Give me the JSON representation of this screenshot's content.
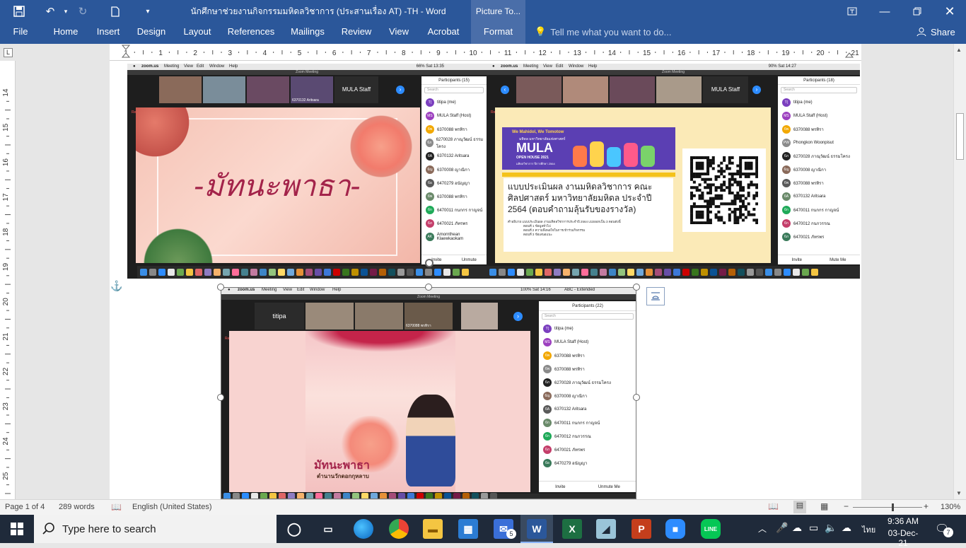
{
  "title_bar": {
    "doc_title": "นักศึกษาช่วยงานกิจกรรมมหิดลวิชาการ (ประสานเรื่อง AT) -TH - Word",
    "context_group": "Picture To...",
    "icons": [
      "save-icon",
      "undo-icon",
      "redo-icon",
      "new-doc-icon",
      "customize-qat-icon",
      "ribbon-display-icon",
      "minimize-icon",
      "restore-icon",
      "close-icon"
    ]
  },
  "ribbon": {
    "tabs": [
      "File",
      "Home",
      "Insert",
      "Design",
      "Layout",
      "References",
      "Mailings",
      "Review",
      "View",
      "Acrobat",
      "Format"
    ],
    "active_tab": "Format",
    "tell_me": "Tell me what you want to do...",
    "share": "Share"
  },
  "ruler": {
    "h_labels": [
      "1",
      "1",
      "2",
      "3",
      "4",
      "5",
      "6",
      "7",
      "8",
      "9",
      "10",
      "11",
      "12",
      "13",
      "14",
      "15",
      "16",
      "17",
      "18",
      "19",
      "20",
      "21"
    ],
    "v_labels": [
      "14",
      "15",
      "16",
      "17",
      "18",
      "19",
      "20",
      "21",
      "22",
      "23",
      "24",
      "25"
    ],
    "corner": "L"
  },
  "shots": {
    "s1": {
      "menu": [
        "zoom.us",
        "Meeting",
        "View",
        "Edit",
        "Window",
        "Help"
      ],
      "sys": "66%  Sat 13:35",
      "window_title": "Zoom Meeting",
      "tile_name": "6370132 Aritsara",
      "host_tile": "MULA Staff",
      "recording": "Recording...",
      "panel_title": "Participants (15)",
      "search": "Search",
      "slide_text": "-มัทนะพาธา-",
      "participants": [
        "titipa (me)",
        "MULA Staff (Host)",
        "6370088 พรทิรา",
        "6270028 ภาณุวัฒน์ ธรรมโครง",
        "6370132 Aritsara",
        "6370008 ญาณิกา",
        "6470279 อนัญญา",
        "6370088 พรทิรา",
        "6470011 กนกกร กาญจน์",
        "6470021 ภัทรพร",
        "Amornthean Klaewkaokam"
      ],
      "buttons": [
        "Invite",
        "Unmute"
      ]
    },
    "s2": {
      "menu": [
        "zoom.us",
        "Meeting",
        "View",
        "Edit",
        "Window",
        "Help"
      ],
      "sys": "90%  Sat 14:27",
      "window_title": "Zoom Meeting",
      "host_tile": "MULA Staff",
      "recording": "Recording...",
      "panel_title": "Participants (18)",
      "search": "Search",
      "banner_top": "We Mahidol, We Tomotow",
      "banner_org": "มหิดล มหาวิทยาลัยแห่งศาสตร์",
      "banner_logo": "MULA",
      "banner_sub": "OPEN HOUSE 2021",
      "banner_sub2": "มหิดลวิชาการ ปีการศึกษา 2564",
      "heading": "แบบประเมินผล งานมหิดลวิชาการ คณะศิลปศาสตร์ มหาวิทยาลัยมหิดล ประจำปี 2564 (ตอบคำถามลุ้นรับของรางวัล)",
      "note_lines": [
        "คำอธิบาย   แบบประเมินผล งานมหิดลวิชาการประจำปี 2564   แบ่งออกเป็น 3 ตอนดังนี้",
        "ตอนที่ 1  ข้อมูลทั่วไป",
        "ตอนที่ 2  ความพึงพอใจในการเข้าร่วมกิจกรรม",
        "ตอนที่ 3  ข้อเสนอแนะ"
      ],
      "participants": [
        "titipa (me)",
        "MULA Staff (Host)",
        "6370088 พรทิรา",
        "Phongkon Woonpisut",
        "6270028 ภาณุวัฒน์ ธรรมโครง",
        "6370008 ญาณิกา",
        "6370088 พรทิรา",
        "6370132 Aritsara",
        "6470011 กนกกร กาญจน์",
        "6470012 กนกวรรณ",
        "6470021 ภัทรพร"
      ],
      "buttons": [
        "Invite",
        "Mute Me"
      ]
    },
    "s3": {
      "menu": [
        "zoom.us",
        "Meeting",
        "View",
        "Edit",
        "Window",
        "Help"
      ],
      "sys": "100%  Sat 14:16",
      "ime": "ABC - Extended",
      "window_title": "Zoom Meeting",
      "host_tile": "titipa",
      "tile_name": "6370088 พรทิรา",
      "recording": "Recording...",
      "panel_title": "Participants (22)",
      "search": "Search",
      "poster_title": "มัทนะพาธา",
      "poster_sub": "ตำนานวักดอกกุหลาบ",
      "participants": [
        "titipa (me)",
        "MULA Staff (Host)",
        "6370088 พรทิรา",
        "6370088 พรทิรา",
        "6270028 ภาณุวัฒน์ ธรรมโครง",
        "6370008 ญาณิกา",
        "6370132 Aritsara",
        "6470011 กนกกร กาญจน์",
        "6470012 กนกวรรณ",
        "6470021 ภัทรพร",
        "6470279 อนัญญา"
      ],
      "buttons": [
        "Invite",
        "Unmute Me"
      ]
    }
  },
  "statusbar": {
    "page": "Page 1 of 4",
    "words": "289 words",
    "language": "English (United States)",
    "zoom": "130%",
    "zoom_level_pct": 130
  },
  "taskbar": {
    "search": "Type here to search",
    "time": "9:36 AM",
    "date": "03-Dec-21",
    "lang": "ไทย",
    "mail_badge": "5",
    "notif_badge": "7",
    "apps": [
      "task-view-icon",
      "edge-icon",
      "chrome-icon",
      "explorer-icon",
      "store-icon",
      "mail-icon",
      "word-icon",
      "excel-icon",
      "files-icon",
      "powerpoint-icon",
      "zoom-icon",
      "line-icon"
    ]
  },
  "colors": {
    "word_blue": "#2b579a",
    "zoom_dark": "#1e1e1e",
    "pink": "#f6c9c1",
    "slide_text": "#a3234a",
    "mula_purple": "#5b3fb3"
  }
}
